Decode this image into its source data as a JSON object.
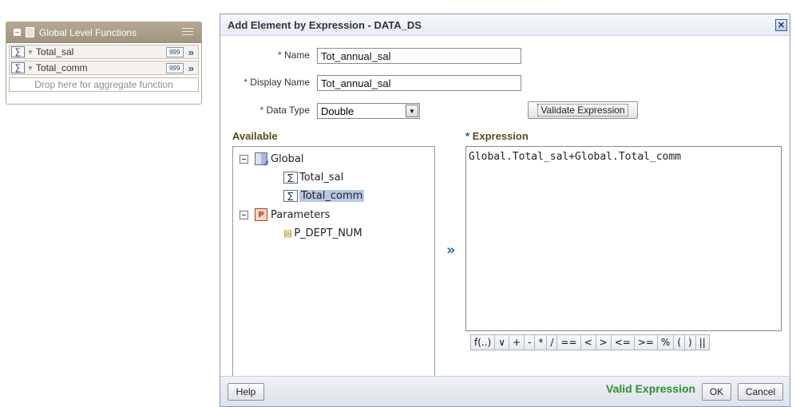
{
  "palette": {
    "title": "Global Level Functions",
    "items": [
      {
        "sigma": "∑",
        "label": "Total_sal",
        "num": "999"
      },
      {
        "sigma": "∑",
        "label": "Total_comm",
        "num": "999"
      }
    ],
    "drop_hint": "Drop here for aggregate function"
  },
  "dialog": {
    "title": "Add Element by Expression - DATA_DS",
    "close": "✕",
    "name_label": "Name",
    "name_value": "Tot_annual_sal",
    "display_name_label": "Display Name",
    "display_name_value": "Tot_annual_sal",
    "data_type_label": "Data Type",
    "data_type_value": "Double",
    "validate_label": "Validate Expression",
    "required_mark": "*",
    "available_label": "Available",
    "expression_label": "Expression",
    "expression_value": "Global.Total_sal+Global.Total_comm",
    "move_arrow": "»",
    "tree": {
      "global_label": "Global",
      "global_children": [
        "Total_sal",
        "Total_comm"
      ],
      "parameters_label": "Parameters",
      "parameter_children": [
        "P_DEPT_NUM"
      ]
    },
    "operators": [
      "f(..)",
      "∨",
      "+",
      "-",
      "*",
      "/",
      "==",
      "<",
      ">",
      "<=",
      ">=",
      "%",
      "(",
      ")",
      "||"
    ],
    "help_label": "Help",
    "valid_status": "Valid Expression",
    "ok_label": "OK",
    "cancel_label": "Cancel"
  }
}
